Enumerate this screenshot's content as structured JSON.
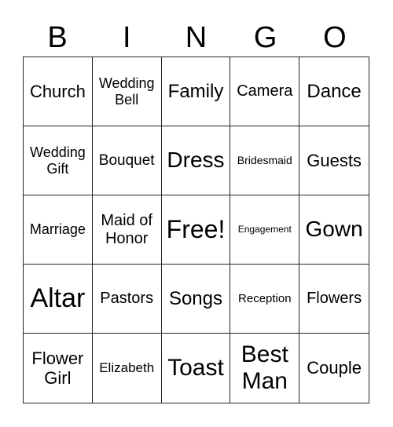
{
  "header": [
    "B",
    "I",
    "N",
    "G",
    "O"
  ],
  "cells": [
    "Church",
    "Wedding Bell",
    "Family",
    "Camera",
    "Dance",
    "Wedding Gift",
    "Bouquet",
    "Dress",
    "Bridesmaid",
    "Guests",
    "Marriage",
    "Maid of Honor",
    "Free!",
    "Engagement",
    "Gown",
    "Altar",
    "Pastors",
    "Songs",
    "Reception",
    "Flowers",
    "Flower Girl",
    "Elizabeth",
    "Toast",
    "Best Man",
    "Couple"
  ]
}
